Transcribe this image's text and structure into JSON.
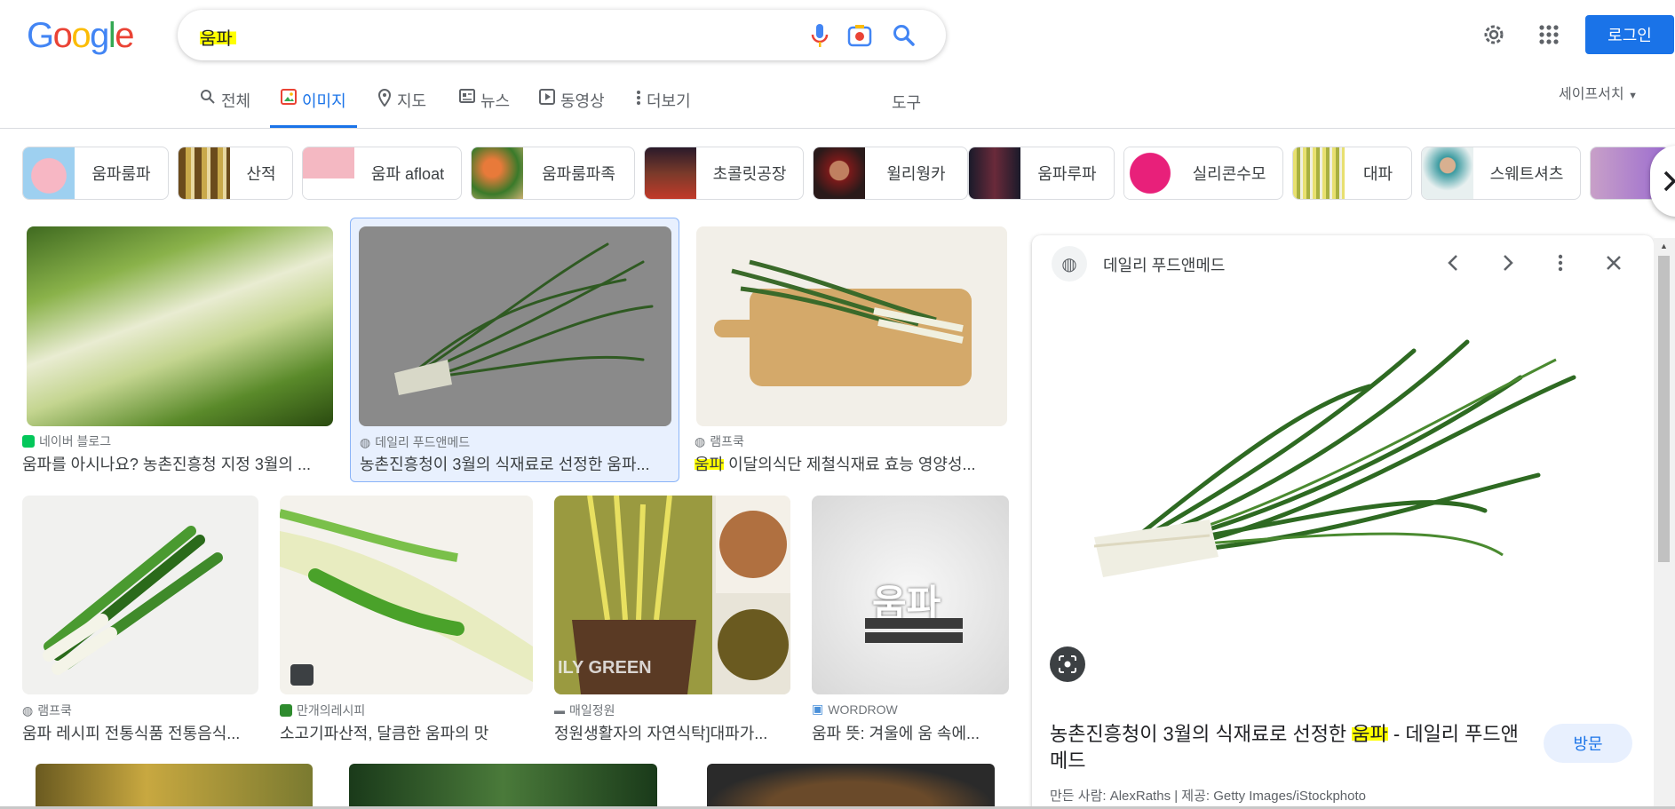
{
  "logo": {
    "g1": "G",
    "g2": "o",
    "g3": "o",
    "g4": "g",
    "g5": "l",
    "g6": "e"
  },
  "search": {
    "query": "움파"
  },
  "header": {
    "login_label": "로그인"
  },
  "tabs": [
    {
      "label": "전체"
    },
    {
      "label": "이미지"
    },
    {
      "label": "지도"
    },
    {
      "label": "뉴스"
    },
    {
      "label": "동영상"
    },
    {
      "label": "더보기"
    }
  ],
  "tools_label": "도구",
  "safesearch_label": "세이프서치",
  "chips": [
    {
      "label": "움파룸파"
    },
    {
      "label": "산적"
    },
    {
      "label": "움파 afloat"
    },
    {
      "label": "움파룸파족"
    },
    {
      "label": "초콜릿공장"
    },
    {
      "label": "윌리웡카"
    },
    {
      "label": "움파루파"
    },
    {
      "label": "실리콘수모"
    },
    {
      "label": "대파"
    },
    {
      "label": "스웨트셔츠"
    }
  ],
  "results": [
    {
      "source": "네이버 블로그",
      "title": "움파를 아시나요? 농촌진흥청 지정 3월의 ..."
    },
    {
      "source": "데일리 푸드앤메드",
      "title": "농촌진흥청이 3월의 식재료로 선정한 움파..."
    },
    {
      "source": "램프쿡",
      "title_hl": "움파",
      "title": " 이달의식단 제철식재료 효능 영양성..."
    },
    {
      "source": "램프쿡",
      "title": "움파 레시피 전통식품 전통음식..."
    },
    {
      "source": "만개의레시피",
      "title": "소고기파산적, 달큼한 움파의 맛"
    },
    {
      "source": "매일정원",
      "title": "정원생활자의 자연식탁]대파가..."
    },
    {
      "source": "WORDROW",
      "title": "움파 뜻: 겨울에 움 속에..."
    }
  ],
  "thumb_overlay": {
    "umpa_text": "움파",
    "green_text": "ILY GREEN"
  },
  "panel": {
    "site": "데일리 푸드앤메드",
    "title_a": "농촌진흥청이 3월의 식재료로 선정한 ",
    "title_hl": "움파",
    "title_b": " - 데일리 푸드앤메드",
    "visit_label": "방문",
    "credit": "만든 사람: AlexRaths | 제공: Getty Images/iStockphoto"
  },
  "colors": {
    "accent": "#1a73e8",
    "highlight": "#ffff00"
  }
}
